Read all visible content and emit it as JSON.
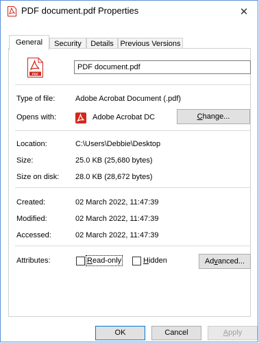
{
  "window": {
    "title": "PDF document.pdf Properties",
    "close_glyph": "✕"
  },
  "tabs": [
    {
      "label": "General",
      "active": true
    },
    {
      "label": "Security",
      "active": false
    },
    {
      "label": "Details",
      "active": false
    },
    {
      "label": "Previous Versions",
      "active": false
    }
  ],
  "file": {
    "icon": "pdf-file-icon",
    "name": "PDF document.pdf"
  },
  "type": {
    "label": "Type of file:",
    "value": "Adobe Acrobat Document (.pdf)"
  },
  "opens_with": {
    "label": "Opens with:",
    "app": "Adobe Acrobat DC",
    "app_icon": "adobe-acrobat-icon",
    "change_prefix": "",
    "change_u": "C",
    "change_rest": "hange..."
  },
  "location": {
    "label": "Location:",
    "value": "C:\\Users\\Debbie\\Desktop"
  },
  "size": {
    "label": "Size:",
    "value": "25.0 KB (25,680 bytes)"
  },
  "size_on_disk": {
    "label": "Size on disk:",
    "value": "28.0 KB (28,672 bytes)"
  },
  "created": {
    "label": "Created:",
    "value": "02 March 2022, 11:47:39"
  },
  "modified": {
    "label": "Modified:",
    "value": "02 March 2022, 11:47:39"
  },
  "accessed": {
    "label": "Accessed:",
    "value": "02 March 2022, 11:47:39"
  },
  "attributes": {
    "label": "Attributes:",
    "readonly_u": "R",
    "readonly_rest": "ead-only",
    "readonly_checked": false,
    "hidden_u": "H",
    "hidden_rest": "idden",
    "hidden_checked": false,
    "advanced_prefix": "Ad",
    "advanced_u": "v",
    "advanced_rest": "anced..."
  },
  "buttons": {
    "ok": "OK",
    "cancel": "Cancel",
    "apply_u": "A",
    "apply_rest": "pply"
  },
  "colors": {
    "accent": "#0078d7",
    "window_border": "#5a8fd6",
    "pdf_red": "#d4261c"
  }
}
